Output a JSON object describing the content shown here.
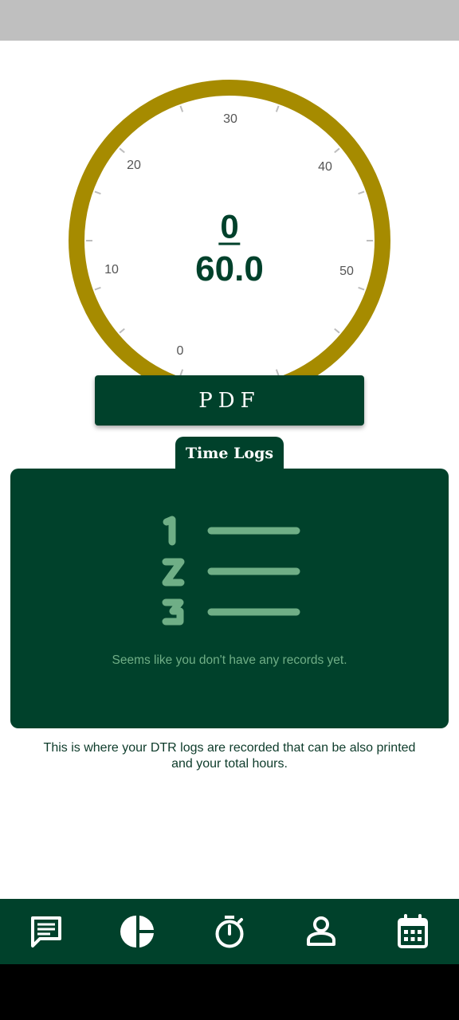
{
  "gauge": {
    "current": "0",
    "total": "60.0",
    "scale_labels": [
      "0",
      "10",
      "20",
      "30",
      "40",
      "50"
    ],
    "ring_color": "#a68b00",
    "text_color": "#00412b"
  },
  "pdf_button": {
    "label": "PDF"
  },
  "time_logs": {
    "tab_label": "Time Logs",
    "empty_message": "Seems like you don't have any records yet.",
    "icon": "numbered-list-icon"
  },
  "caption": "This is where your DTR logs are recorded that can be also printed and your total hours.",
  "bottom_nav": {
    "items": [
      {
        "icon": "chat-icon"
      },
      {
        "icon": "pie-chart-icon"
      },
      {
        "icon": "stopwatch-icon"
      },
      {
        "icon": "profile-icon"
      },
      {
        "icon": "calendar-icon"
      }
    ]
  },
  "colors": {
    "primary": "#00412b",
    "accent": "#a68b00",
    "muted_green": "#6fae86",
    "status_bar": "#bfbfbf"
  }
}
